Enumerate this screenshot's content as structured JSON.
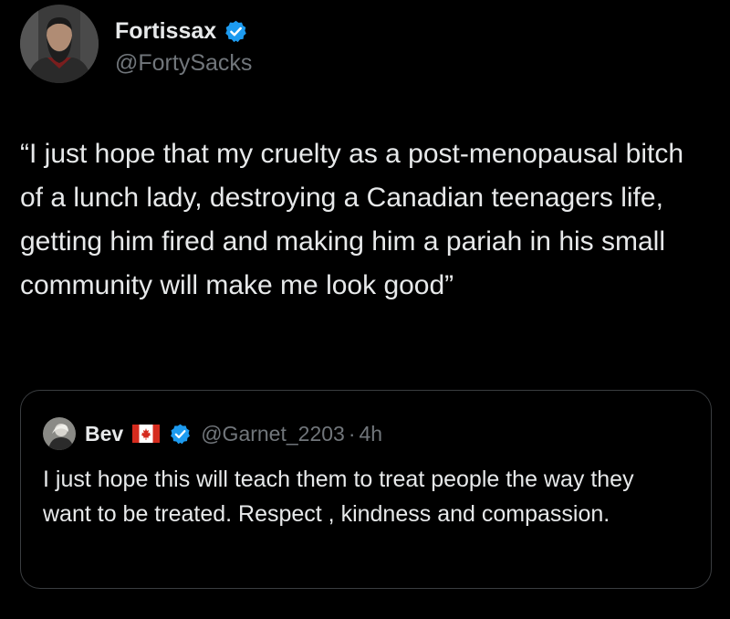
{
  "post": {
    "author": {
      "display_name": "Fortissax",
      "handle": "@FortySacks",
      "verified": true,
      "avatar_icon": "bearded-man-avatar"
    },
    "text": "“I just hope that my cruelty as a post-menopausal bitch of a lunch lady, destroying a Canadian teenagers life, getting him fired and making him a pariah in his small community will make me look good”"
  },
  "quoted_post": {
    "author": {
      "display_name": "Bev",
      "flag_icon": "canada-flag-icon",
      "verified": true,
      "handle": "@Garnet_2203",
      "separator": "·",
      "time": "4h",
      "avatar_icon": "person-avatar"
    },
    "text": "I just hope this will teach them to treat people the way they want to be treated.  Respect , kindness and compassion."
  },
  "colors": {
    "background": "#000000",
    "text_primary": "#e7e9ea",
    "text_secondary": "#71767b",
    "verified_blue": "#1d9bf0",
    "border": "#3a3d40",
    "flag_red": "#d52b1e"
  }
}
